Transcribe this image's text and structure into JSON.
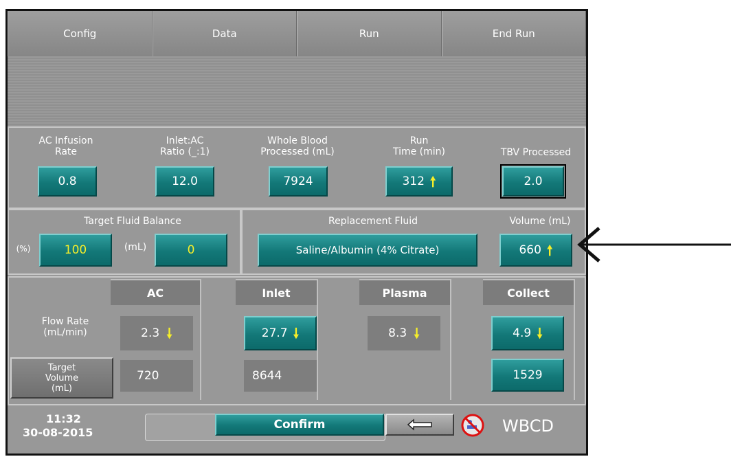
{
  "tabs": [
    "Config",
    "Data",
    "Run",
    "End Run"
  ],
  "metrics": {
    "ac_infusion_label": "AC Infusion\nRate",
    "ac_infusion_value": "0.8",
    "inlet_ac_label": "Inlet:AC\nRatio (_:1)",
    "inlet_ac_value": "12.0",
    "whole_blood_label": "Whole Blood\nProcessed (mL)",
    "whole_blood_value": "7924",
    "run_time_label": "Run\nTime (min)",
    "run_time_value": "312",
    "tbv_label": "TBV Processed",
    "tbv_value": "2.0"
  },
  "fluid_balance": {
    "title": "Target Fluid Balance",
    "percent_unit": "(%)",
    "percent_value": "100",
    "ml_unit": "(mL)",
    "ml_value": "0"
  },
  "replacement": {
    "title": "Replacement Fluid",
    "fluid_value": "Saline/Albumin (4% Citrate)",
    "volume_label": "Volume (mL)",
    "volume_value": "660"
  },
  "flow": {
    "columns": [
      "AC",
      "Inlet",
      "Plasma",
      "Collect"
    ],
    "flow_rate_label": "Flow Rate\n(mL/min)",
    "target_volume_label": "Target\nVolume\n(mL)",
    "ac_rate": "2.3",
    "inlet_rate": "27.7",
    "plasma_rate": "8.3",
    "collect_rate": "4.9",
    "ac_volume": "720",
    "inlet_volume": "8644",
    "collect_volume": "1529"
  },
  "footer": {
    "time": "11:32",
    "date": "30-08-2015",
    "confirm_label": "Confirm",
    "mode": "WBCD"
  },
  "icons": {
    "up_arrow": "arrow-up-icon",
    "down_arrow": "arrow-down-icon",
    "back": "return-icon",
    "no_patient": "no-patient-icon"
  },
  "colors": {
    "teal": "#137878",
    "highlight_yellow": "#f5ee2a",
    "panel_gray": "#989898"
  }
}
